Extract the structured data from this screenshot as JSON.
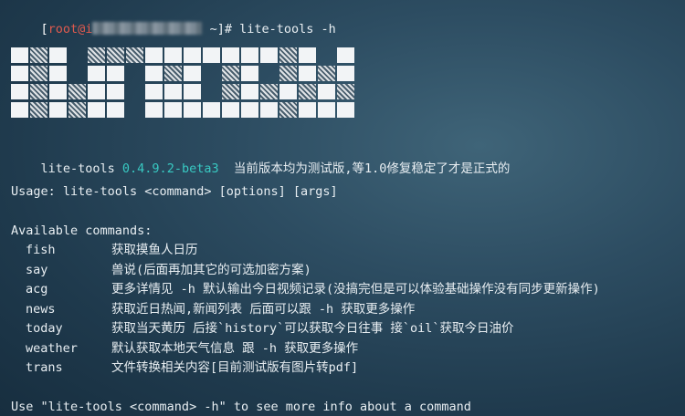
{
  "prompt": {
    "bracket_open": "[",
    "user": "root@i",
    "host_tail": " ~]# ",
    "command": "lite-tools -h"
  },
  "version_line": {
    "name": "lite-tools ",
    "version": "0.4.9.2-beta3",
    "notice": "  当前版本均为测试版,等1.0修复稳定了才是正式的"
  },
  "usage": "Usage: lite-tools <command> [options] [args]",
  "available_header": "Available commands:",
  "commands": [
    {
      "name": "fish",
      "desc": "获取摸鱼人日历"
    },
    {
      "name": "say",
      "desc": "兽说(后面再加其它的可选加密方案)"
    },
    {
      "name": "acg",
      "desc": "更多详情见 -h 默认输出今日视频记录(没搞完但是可以体验基础操作没有同步更新操作)"
    },
    {
      "name": "news",
      "desc": "获取近日热闻,新闻列表 后面可以跟 -h 获取更多操作"
    },
    {
      "name": "today",
      "desc": "获取当天黄历 后接`history`可以获取今日往事 接`oil`获取今日油价"
    },
    {
      "name": "weather",
      "desc": "默认获取本地天气信息 跟 -h 获取更多操作"
    },
    {
      "name": "trans",
      "desc": "文件转换相关内容[目前测试版有图片转pdf]"
    }
  ],
  "footer": "Use \"lite-tools <command> -h\" to see more info about a command",
  "banner": {
    "rows": [
      "SDSEDDDSSSSSSSDSESSDSEDDDSSSSS",
      "SDSESSESDSEDSEDSDSDSEDSSSSESDS",
      "SDSDSSESSSEDSDSDSDSESSSSSESSSD",
      "SDSDSSESSSSSSSDSSSDSDSSSSSSESS"
    ]
  },
  "colors": {
    "user": "#e05a4e",
    "version": "#38c9c2",
    "text": "#e8eef2"
  }
}
